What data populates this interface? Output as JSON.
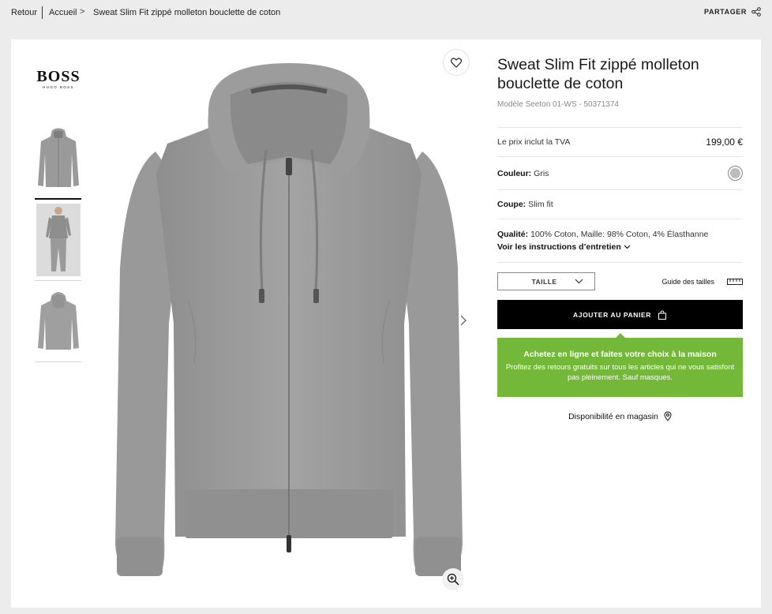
{
  "breadcrumb": {
    "back": "Retour",
    "home": "Accueil",
    "current": "Sweat Slim Fit zippé molleton bouclette de coton"
  },
  "share": {
    "label": "PARTAGER",
    "icon": "share-icon"
  },
  "brand": {
    "name": "BOSS",
    "sub": "HUGO BOSS"
  },
  "gallery": {
    "thumbnails": [
      "hoodie-front",
      "model-wearing",
      "hoodie-back"
    ],
    "active_index": 0
  },
  "product": {
    "title": "Sweat Slim Fit zippé molleton bouclette de coton",
    "model": "Modèle Seeton 01-WS - 50371374",
    "price_label": "Le prix inclut la TVA",
    "price": "199,00 €",
    "color_label": "Couleur:",
    "color_value": "Gris",
    "swatch_color": "#bdbdbd",
    "fit_label": "Coupe:",
    "fit_value": "Slim fit",
    "quality_label": "Qualité:",
    "quality_value": "100% Coton, Maille: 98% Coton, 4% Élasthanne",
    "care_link": "Voir les instructions d’entretien"
  },
  "size": {
    "select_label": "TAILLE",
    "guide_label": "Guide des tailles"
  },
  "cart": {
    "button_label": "AJOUTER AU PANIER"
  },
  "promo": {
    "title": "Achetez en ligne et faites votre choix à la maison",
    "text": "Profitez des retours gratuits sur tous les articles qui ne vous satisfont pas pleinement. Sauf masques.",
    "color": "#74b83a"
  },
  "store": {
    "label": "Disponibilité en magasin"
  }
}
